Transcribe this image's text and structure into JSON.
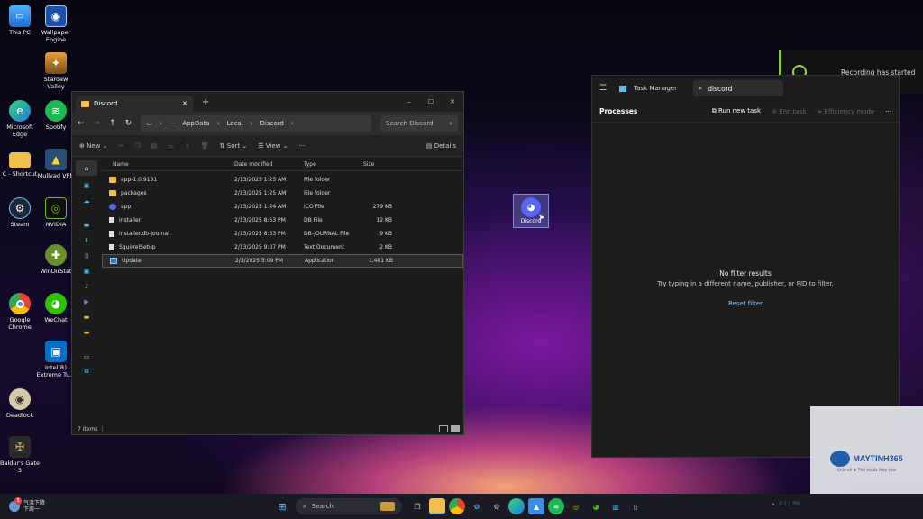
{
  "desktop": {
    "icons": [
      {
        "label": "This PC",
        "icon": "monitor-icon"
      },
      {
        "label": "Wallpaper Engine",
        "icon": "wallpaper-engine-icon"
      },
      {
        "label": "Stardew Valley",
        "icon": "stardew-icon"
      },
      {
        "label": "Microsoft Edge",
        "icon": "edge-icon"
      },
      {
        "label": "Spotify",
        "icon": "spotify-icon"
      },
      {
        "label": "C - Shortcut",
        "icon": "folder-icon"
      },
      {
        "label": "Mullvad VPN",
        "icon": "mullvad-icon"
      },
      {
        "label": "Steam",
        "icon": "steam-icon"
      },
      {
        "label": "NVIDIA",
        "icon": "nvidia-icon"
      },
      {
        "label": "WinDirStat",
        "icon": "windirstat-icon"
      },
      {
        "label": "Google Chrome",
        "icon": "chrome-icon"
      },
      {
        "label": "WeChat",
        "icon": "wechat-icon"
      },
      {
        "label": "Intel(R) Extreme Tu...",
        "icon": "intel-icon"
      },
      {
        "label": "Deadlock",
        "icon": "deadlock-icon"
      },
      {
        "label": "Baldur's Gate 3",
        "icon": "baldurs-gate-icon"
      },
      {
        "label": "Discord",
        "icon": "discord-icon"
      }
    ]
  },
  "explorer": {
    "tab_title": "Discord",
    "breadcrumb": [
      "AppData",
      "Local",
      "Discord"
    ],
    "search_placeholder": "Search Discord",
    "toolbar": {
      "new": "New",
      "sort": "Sort",
      "view": "View",
      "details": "Details"
    },
    "columns": [
      "Name",
      "Date modified",
      "Type",
      "Size"
    ],
    "files": [
      {
        "name": "app-1.0.9181",
        "date": "2/13/2025 1:25 AM",
        "type": "File folder",
        "size": "",
        "icon": "folder-icon"
      },
      {
        "name": "packages",
        "date": "2/13/2025 1:25 AM",
        "type": "File folder",
        "size": "",
        "icon": "folder-icon"
      },
      {
        "name": "app",
        "date": "2/13/2025 1:24 AM",
        "type": "ICO File",
        "size": "279 KB",
        "icon": "discord-icon"
      },
      {
        "name": "installer",
        "date": "2/13/2025 8:53 PM",
        "type": "DB File",
        "size": "12 KB",
        "icon": "file-icon"
      },
      {
        "name": "installer.db-journal",
        "date": "2/13/2025 8:53 PM",
        "type": "DB-JOURNAL File",
        "size": "9 KB",
        "icon": "file-icon"
      },
      {
        "name": "SquirrelSetup",
        "date": "2/13/2025 9:07 PM",
        "type": "Text Document",
        "size": "2 KB",
        "icon": "text-file-icon"
      },
      {
        "name": "Update",
        "date": "2/3/2025 5:09 PM",
        "type": "Application",
        "size": "1,481 KB",
        "icon": "app-icon"
      }
    ],
    "status": "7 items"
  },
  "taskmanager": {
    "title": "Task Manager",
    "search_value": "discord",
    "section": "Processes",
    "actions": {
      "run": "Run new task",
      "end": "End task",
      "efficiency": "Efficiency mode"
    },
    "empty_title": "No filter results",
    "empty_sub": "Try typing in a different name, publisher, or PID to filter.",
    "reset": "Reset filter"
  },
  "recording": {
    "text": "Recording has started"
  },
  "watermark": {
    "brand": "MAYTINH365",
    "tagline": "Chia sẻ & Thủ thuật Máy tính"
  },
  "taskbar": {
    "weather_line1": "气温下降",
    "weather_line2": "下周一",
    "search_placeholder": "Search",
    "clock": "9:11 PM",
    "notification_count": "3"
  },
  "colors": {
    "accent": "#4cc2ff",
    "discord": "#5865f2",
    "folder": "#f0c04a"
  }
}
